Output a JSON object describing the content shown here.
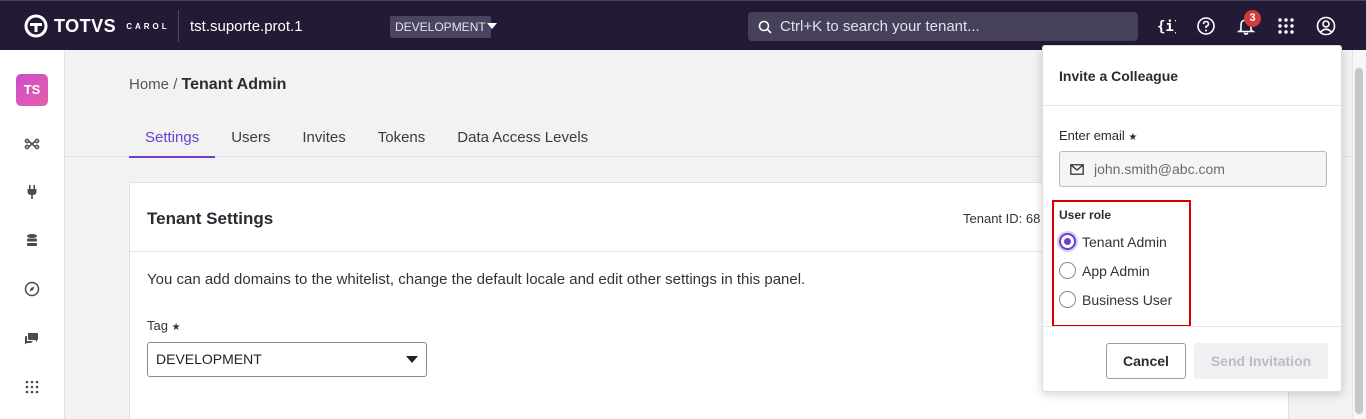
{
  "topbar": {
    "logo_text": "TOTVS",
    "logo_sub": "CAROL",
    "tenant_name": "tst.suporte.prot.1",
    "environment": "DEVELOPMENT",
    "search_placeholder": "Ctrl+K to search your tenant...",
    "notification_count": "3",
    "icons": [
      "code-braces-icon",
      "help-icon",
      "bell-icon",
      "apps-grid-icon",
      "user-account-icon"
    ]
  },
  "sidebar": {
    "avatar_initials": "TS",
    "icons": [
      "connectors-icon",
      "plug-icon",
      "database-icon",
      "compass-icon",
      "chat-icon",
      "apps-icon"
    ]
  },
  "main": {
    "breadcrumb_home": "Home",
    "breadcrumb_sep": "/",
    "breadcrumb_current": "Tenant Admin",
    "tabs": [
      {
        "label": "Settings",
        "active": true
      },
      {
        "label": "Users",
        "active": false
      },
      {
        "label": "Invites",
        "active": false
      },
      {
        "label": "Tokens",
        "active": false
      },
      {
        "label": "Data Access Levels",
        "active": false
      }
    ],
    "card": {
      "title": "Tenant Settings",
      "tenant_id_label": "Tenant ID: 68",
      "description": "You can add domains to the whitelist, change the default locale and edit other settings in this panel.",
      "tag_label": "Tag",
      "tag_value": "DEVELOPMENT"
    }
  },
  "invite": {
    "title": "Invite a Colleague",
    "email_label": "Enter email",
    "email_placeholder": "john.smith@abc.com",
    "role_label": "User role",
    "roles": [
      {
        "label": "Tenant Admin",
        "checked": true
      },
      {
        "label": "App Admin",
        "checked": false
      },
      {
        "label": "Business User",
        "checked": false
      }
    ],
    "cancel_label": "Cancel",
    "send_label": "Send Invitation"
  },
  "colors": {
    "topbar_bg": "#231b35",
    "accent": "#6b3fd1",
    "badge_red": "#d43a3a",
    "highlight_box": "#d90000"
  }
}
